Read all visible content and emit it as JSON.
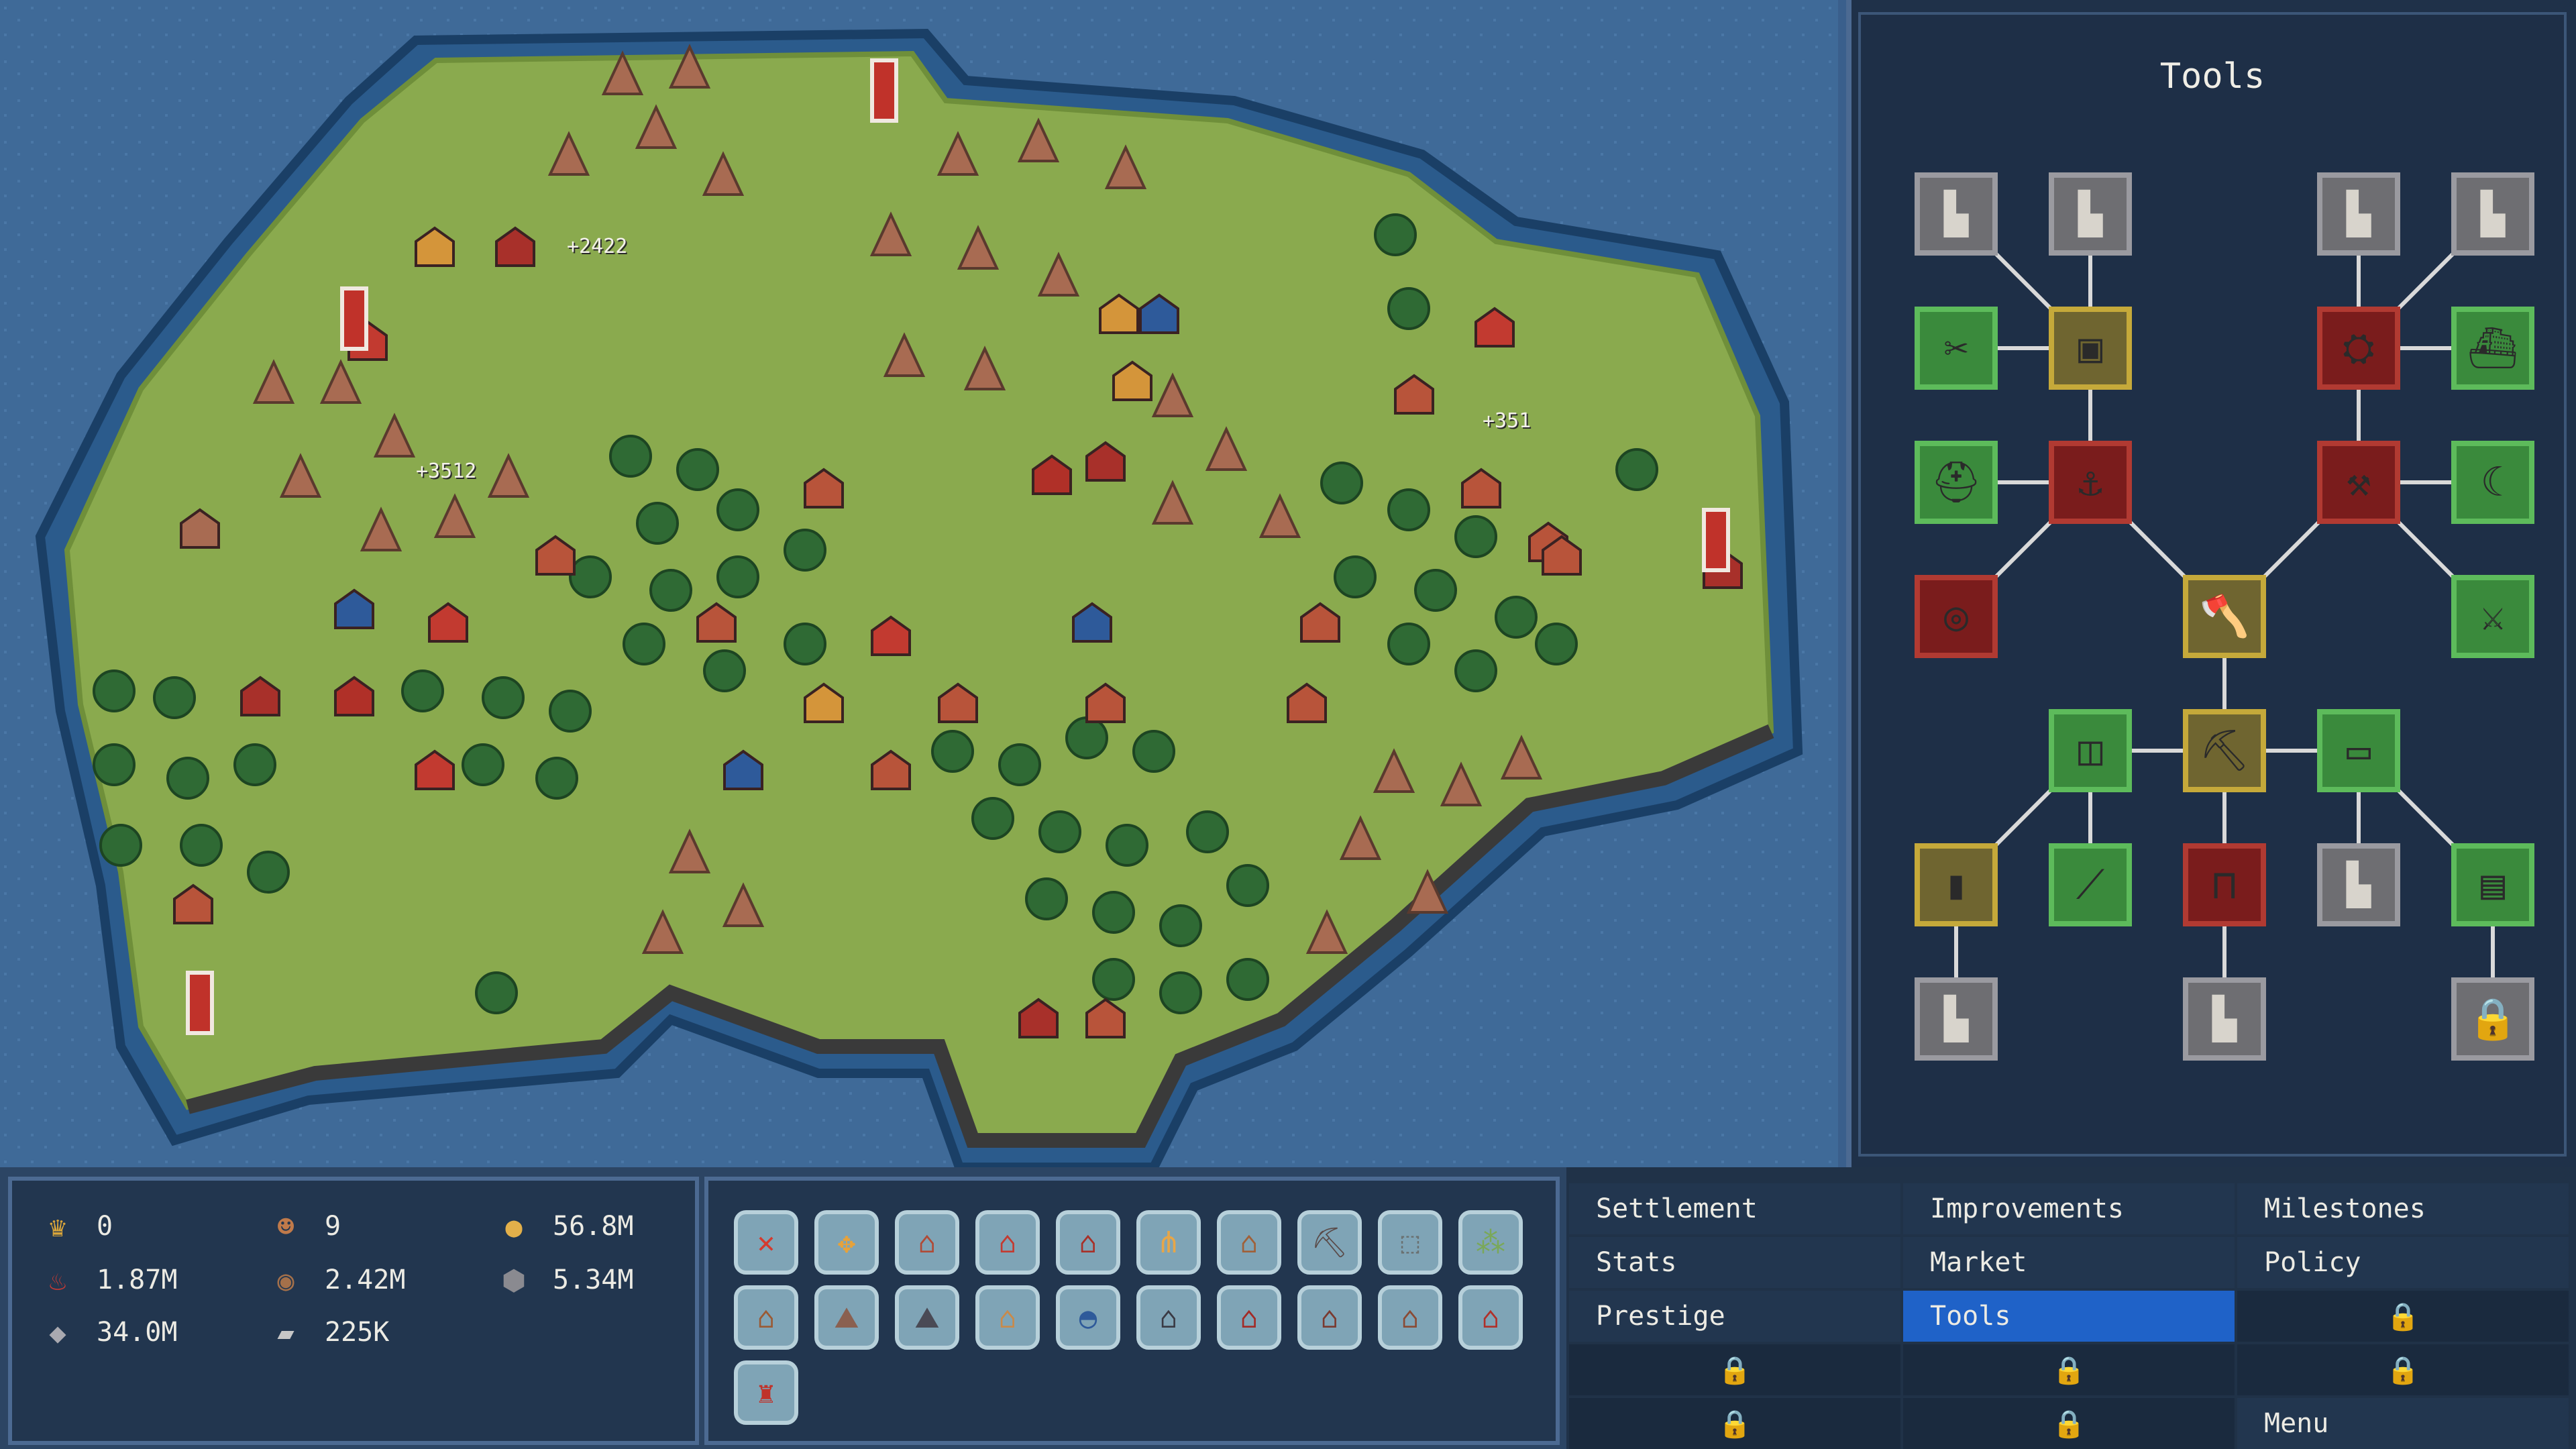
{
  "panel": {
    "title": "Tools"
  },
  "map_floaters": [
    "+2422",
    "+3512",
    "+351"
  ],
  "resources": [
    {
      "icon": "crown-icon",
      "glyph": "♛",
      "color": "#d9a53a",
      "value": "0"
    },
    {
      "icon": "worker-icon",
      "glyph": "☻",
      "color": "#c07a4a",
      "value": "9"
    },
    {
      "icon": "coin-icon",
      "glyph": "●",
      "color": "#e3b04a",
      "value": "56.8M"
    },
    {
      "icon": "meat-icon",
      "glyph": "♨",
      "color": "#c43a34",
      "value": "1.87M"
    },
    {
      "icon": "wood-log-icon",
      "glyph": "◉",
      "color": "#a4704a",
      "value": "2.42M"
    },
    {
      "icon": "stone-icon",
      "glyph": "⬢",
      "color": "#8a8a90",
      "value": "5.34M"
    },
    {
      "icon": "iron-icon",
      "glyph": "◆",
      "color": "#a9a9b0",
      "value": "34.0M"
    },
    {
      "icon": "plank-icon",
      "glyph": "▰",
      "color": "#c7c7c7",
      "value": "225K"
    }
  ],
  "build_slots": [
    {
      "icon": "demolish-x-icon",
      "glyph": "✕",
      "color": "#d53a2e"
    },
    {
      "icon": "move-arrows-icon",
      "glyph": "✥",
      "color": "#e7a23a"
    },
    {
      "icon": "hut-icon",
      "glyph": "⌂",
      "color": "#b04a36"
    },
    {
      "icon": "house-icon",
      "glyph": "⌂",
      "color": "#c43a30"
    },
    {
      "icon": "manor-icon",
      "glyph": "⌂",
      "color": "#a83028"
    },
    {
      "icon": "wheat-field-icon",
      "glyph": "⋔",
      "color": "#e7a648"
    },
    {
      "icon": "workshop-icon",
      "glyph": "⌂",
      "color": "#a06038"
    },
    {
      "icon": "mine-icon",
      "glyph": "⛏",
      "color": "#5a4a48"
    },
    {
      "icon": "quarry-icon",
      "glyph": "⬚",
      "color": "#6a7070"
    },
    {
      "icon": "farm-plot-icon",
      "glyph": "⁂",
      "color": "#7aa858"
    },
    {
      "icon": "lumber-hut-icon",
      "glyph": "⌂",
      "color": "#9a5a34"
    },
    {
      "icon": "stone-mine-icon",
      "glyph": "⛰",
      "color": "#8a6050"
    },
    {
      "icon": "iron-mine-icon",
      "glyph": "⛰",
      "color": "#4a4a55"
    },
    {
      "icon": "bakery-icon",
      "glyph": "⌂",
      "color": "#c98a4a"
    },
    {
      "icon": "blue-dome-icon",
      "glyph": "◓",
      "color": "#2e5a9a"
    },
    {
      "icon": "smelter-icon",
      "glyph": "⌂",
      "color": "#3a3a44"
    },
    {
      "icon": "barn-icon",
      "glyph": "⌂",
      "color": "#a32a26"
    },
    {
      "icon": "forge-icon",
      "glyph": "⌂",
      "color": "#7a3a30"
    },
    {
      "icon": "storehouse-icon",
      "glyph": "⌂",
      "color": "#8a4a34"
    },
    {
      "icon": "market-icon",
      "glyph": "⌂",
      "color": "#b0302a"
    },
    {
      "icon": "lighthouse-icon",
      "glyph": "♜",
      "color": "#c0322a"
    }
  ],
  "menu": {
    "settlement": "Settlement",
    "improvements": "Improvements",
    "milestones": "Milestones",
    "stats": "Stats",
    "market": "Market",
    "policy": "Policy",
    "prestige": "Prestige",
    "tools": "Tools",
    "menu": "Menu"
  },
  "tool_tree": [
    {
      "id": "anvil-upgrade-1",
      "icon": "anvil-icon",
      "glyph": "▙",
      "tier": "gray"
    },
    {
      "id": "anvil-upgrade-2",
      "icon": "anvil-icon",
      "glyph": "▙",
      "tier": "gray"
    },
    {
      "id": "anvil-upgrade-3",
      "icon": "anvil-icon",
      "glyph": "▙",
      "tier": "gray"
    },
    {
      "id": "anvil-upgrade-4",
      "icon": "anvil-icon",
      "glyph": "▙",
      "tier": "gray"
    },
    {
      "id": "pliers",
      "icon": "pliers-icon",
      "glyph": "✂",
      "tier": "green"
    },
    {
      "id": "furnace",
      "icon": "furnace-icon",
      "glyph": "▣",
      "tier": "gold"
    },
    {
      "id": "mill",
      "icon": "mill-icon",
      "glyph": "⛭",
      "tier": "red"
    },
    {
      "id": "boat",
      "icon": "boat-icon",
      "glyph": "⛴",
      "tier": "green"
    },
    {
      "id": "helmet",
      "icon": "helmet-icon",
      "glyph": "⛑",
      "tier": "green"
    },
    {
      "id": "hook",
      "icon": "hook-icon",
      "glyph": "⚓",
      "tier": "red"
    },
    {
      "id": "scythe",
      "icon": "scythe-icon",
      "glyph": "⚒",
      "tier": "red"
    },
    {
      "id": "sickle",
      "icon": "sickle-icon",
      "glyph": "☾",
      "tier": "green"
    },
    {
      "id": "log-disc",
      "icon": "log-disc-icon",
      "glyph": "◎",
      "tier": "red"
    },
    {
      "id": "axe",
      "icon": "axe-icon",
      "glyph": "🪓",
      "tier": "gold"
    },
    {
      "id": "battle-axe",
      "icon": "battle-axe-icon",
      "glyph": "⚔",
      "tier": "green"
    },
    {
      "id": "bucket",
      "icon": "bucket-icon",
      "glyph": "◫",
      "tier": "green"
    },
    {
      "id": "pickaxe",
      "icon": "pickaxe-icon",
      "glyph": "⛏",
      "tier": "gold"
    },
    {
      "id": "minecart",
      "icon": "minecart-icon",
      "glyph": "▭",
      "tier": "green"
    },
    {
      "id": "book",
      "icon": "book-icon",
      "glyph": "▮",
      "tier": "gold"
    },
    {
      "id": "knife",
      "icon": "knife-icon",
      "glyph": "⟋",
      "tier": "green"
    },
    {
      "id": "rake",
      "icon": "rake-icon",
      "glyph": "⊓",
      "tier": "red"
    },
    {
      "id": "anvil-upgrade-5",
      "icon": "anvil-icon",
      "glyph": "▙",
      "tier": "gray"
    },
    {
      "id": "scroll",
      "icon": "scroll-icon",
      "glyph": "▤",
      "tier": "green"
    },
    {
      "id": "anvil-upgrade-6",
      "icon": "anvil-icon",
      "glyph": "▙",
      "tier": "gray"
    },
    {
      "id": "anvil-upgrade-7",
      "icon": "anvil-icon",
      "glyph": "▙",
      "tier": "gray"
    },
    {
      "id": "locked-tool",
      "icon": "lock-icon",
      "glyph": "🔒",
      "tier": "gray"
    }
  ]
}
